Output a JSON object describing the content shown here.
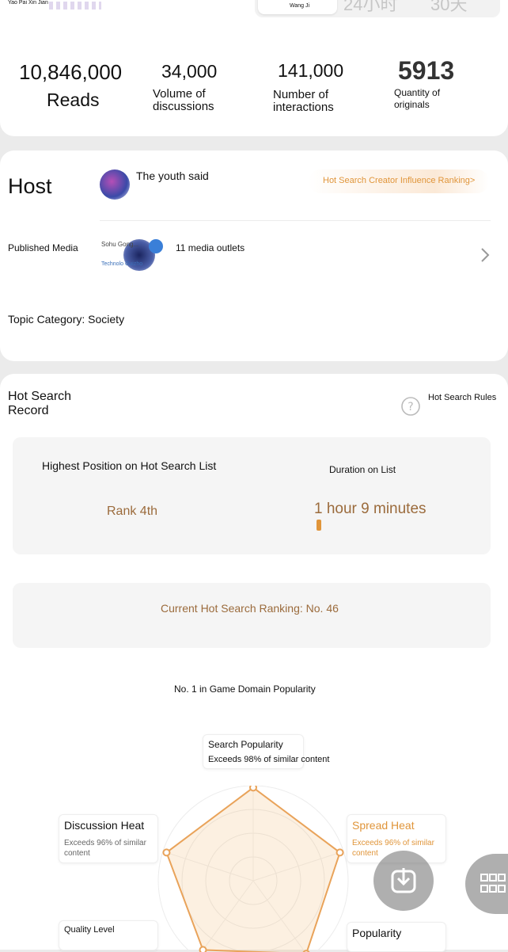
{
  "header": {
    "app_text": "Yao Pai Xin Jian",
    "tab_active": "Wang Ji",
    "tab_2": "24小时",
    "tab_3": "30天"
  },
  "stats": {
    "reads_value": "10,846,000",
    "reads_label": "Reads",
    "discussions_value": "34,000",
    "discussions_label_1": "Volume of",
    "discussions_label_2": "discussions",
    "interactions_value": "141,000",
    "interactions_label_1": "Number of",
    "interactions_label_2": "interactions",
    "originals_value": "5913",
    "originals_label_1": "Quantity of",
    "originals_label_2": "originals"
  },
  "host": {
    "title": "Host",
    "name": "The youth said",
    "ranking_link": "Hot Search Creator Influence Ranking>",
    "published_media_label": "Published Media",
    "media_logo_1": "Sohu Gong...",
    "media_logo_2": "Technolo Guizho",
    "media_count": "11 media outlets",
    "topic_category": "Topic Category: Society"
  },
  "hot_search": {
    "title_1": "Hot Search",
    "title_2": "Record",
    "rules_label": "Hot Search Rules",
    "highest_position_label": "Highest Position on Hot Search List",
    "highest_position_value": "Rank 4th",
    "duration_label": "Duration on List",
    "duration_value": "1 hour 9 minutes",
    "current_ranking": "Current Hot Search Ranking: No. 46",
    "domain_popularity": "No. 1 in Game Domain Popularity"
  },
  "radar": {
    "values": {
      "search_popularity": 0.98,
      "spread_heat": 0.96,
      "popularity": 0.95,
      "quality_level": 0.9,
      "discussion_heat": 0.96
    },
    "labels": {
      "search_title": "Search Popularity",
      "search_desc": "Exceeds 98% of similar content",
      "spread_title": "Spread Heat",
      "spread_desc_1": "Exceeds 96% of similar",
      "spread_desc_2": "content",
      "discussion_title": "Discussion Heat",
      "discussion_desc_1": "Exceeds 96% of similar",
      "discussion_desc_2": "content",
      "quality_title": "Quality Level",
      "popularity_title": "Popularity"
    }
  },
  "colors": {
    "accent_orange": "#e0953a",
    "accent_brown": "#9b6b3c",
    "card_bg": "#ffffff",
    "page_bg": "#ebebeb"
  },
  "icons": {
    "rules": "question-circle-icon",
    "chevron": "chevron-right-icon",
    "download": "download-icon",
    "grid": "grid-icon"
  }
}
